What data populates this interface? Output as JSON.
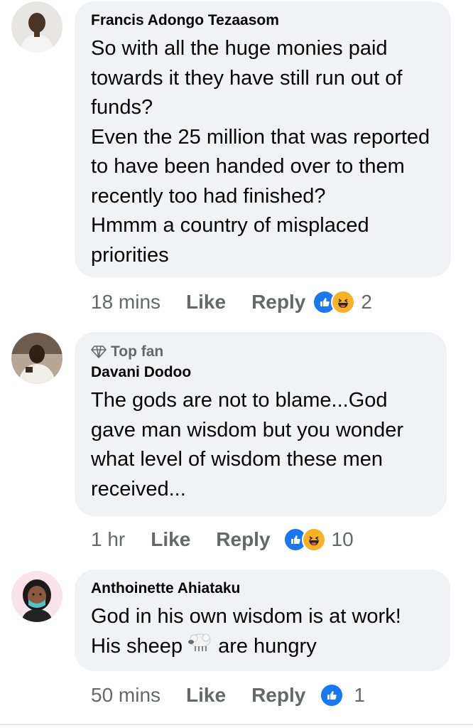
{
  "comments": [
    {
      "name": "Francis Adongo Tezaasom",
      "text": "So with all the huge monies paid towards it they have still run out of funds?\nEven the 25 million that was reported to have been handed over to them recently too had finished?\nHmmm a country of misplaced priorities",
      "time": "18 mins",
      "like_label": "Like",
      "reply_label": "Reply",
      "reaction_icons": [
        "like-icon",
        "haha-icon"
      ],
      "reaction_count": "2"
    },
    {
      "badge": "Top fan",
      "name": "Davani Dodoo",
      "text": "The gods are not to blame...God gave man wisdom but you wonder what level of wisdom these men received...",
      "time": "1 hr",
      "like_label": "Like",
      "reply_label": "Reply",
      "reaction_icons": [
        "like-icon",
        "haha-icon"
      ],
      "reaction_count": "10"
    },
    {
      "name": "Anthoinette Ahiataku",
      "text_before_emoji": "God in his own wisdom is at work!\nHis sheep ",
      "emoji": "sheep-emoji",
      "text_after_emoji": " are hungry",
      "time": "50 mins",
      "like_label": "Like",
      "reply_label": "Reply",
      "reaction_icons": [
        "like-icon"
      ],
      "reaction_count": "1"
    }
  ],
  "colors": {
    "bubble": "#f0f2f5",
    "secondary_text": "#65676b",
    "like_blue": "#1877f2",
    "haha_yellow": "#f7b125"
  }
}
